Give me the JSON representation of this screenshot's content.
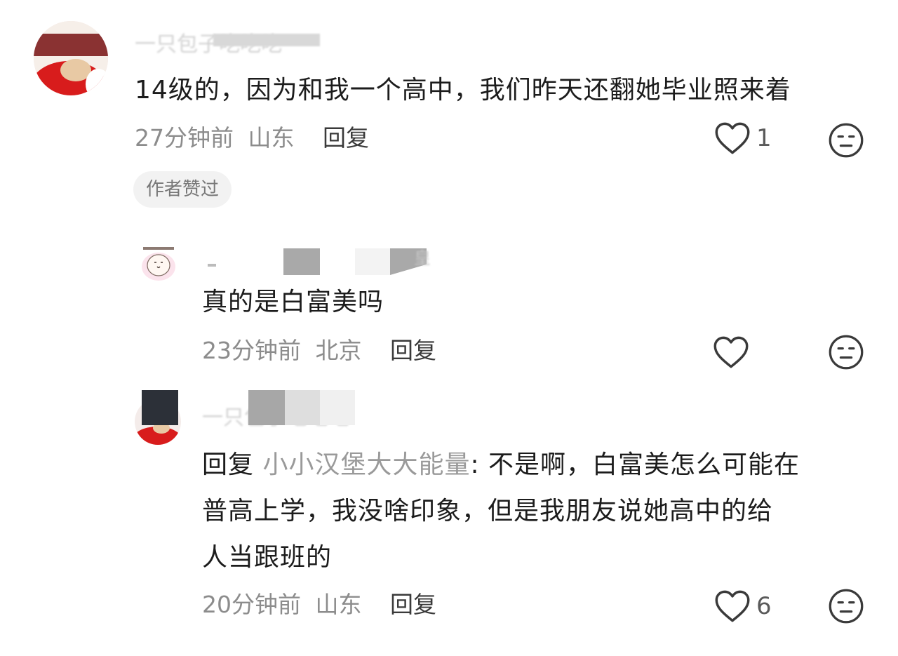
{
  "comments": [
    {
      "username": "一只包子吃吃吃",
      "text": "14级的，因为和我一个高中，我们昨天还翻她毕业照来着",
      "time": "27分钟前",
      "location": "山东",
      "reply_label": "回复",
      "like_count": "1",
      "badge": "作者赞过"
    },
    {
      "username": "皇",
      "text": "真的是白富美吗",
      "time": "23分钟前",
      "location": "北京",
      "reply_label": "回复",
      "like_count": ""
    },
    {
      "username": "一只包子吃吃吃",
      "reply_prefix": "回复",
      "reply_to": "小小汉堡大大能量",
      "text_line1_rest": ": 不是啊，白富美怎么可能在",
      "text_line2": "普高上学，我没啥印象，但是我朋友说她高中的给",
      "text_line3": "人当跟班的",
      "time": "20分钟前",
      "location": "山东",
      "reply_label": "回复",
      "like_count": "6"
    }
  ],
  "colors": {
    "text": "#1c1c1c",
    "meta": "#8c8c8c",
    "reply_target": "#9a9a9a",
    "icon": "#3a3a3a",
    "badge_bg": "#f2f2f2"
  },
  "icons": [
    "heart-icon",
    "emoji-face-icon"
  ]
}
